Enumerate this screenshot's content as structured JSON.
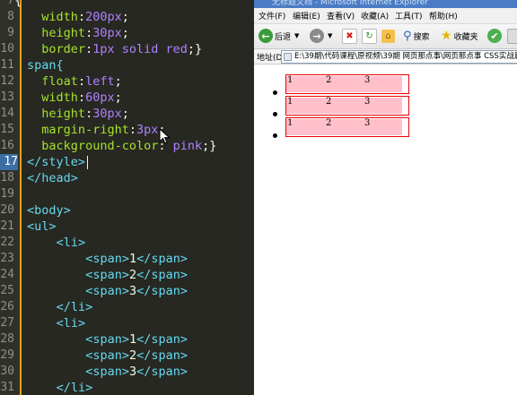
{
  "editor": {
    "lines": [
      {
        "num": "7",
        "text": "  {"
      },
      {
        "num": "8",
        "indent": 2,
        "prop": "width",
        "val": "200px"
      },
      {
        "num": "9",
        "indent": 2,
        "prop": "height",
        "val": "30px"
      },
      {
        "num": "10",
        "indent": 2,
        "prop": "border",
        "val": "1px solid red",
        "close": true
      },
      {
        "num": "11",
        "selector": "span{"
      },
      {
        "num": "12",
        "indent": 2,
        "prop": "float",
        "val": "left"
      },
      {
        "num": "13",
        "indent": 2,
        "prop": "width",
        "val": "60px"
      },
      {
        "num": "14",
        "indent": 2,
        "prop": "height",
        "val": "30px"
      },
      {
        "num": "15",
        "indent": 2,
        "prop": "margin-right",
        "val": "3px"
      },
      {
        "num": "16",
        "indent": 2,
        "prop": "background-color",
        "val": " pink",
        "close": true
      },
      {
        "num": "17",
        "tag": "</style>",
        "active": true
      },
      {
        "num": "18",
        "tag": "</head>"
      },
      {
        "num": "19",
        "text": ""
      },
      {
        "num": "20",
        "tag": "<body>"
      },
      {
        "num": "21",
        "tag": "<ul>"
      },
      {
        "num": "22",
        "indent": 4,
        "tag": "<li>"
      },
      {
        "num": "23",
        "indent": 8,
        "tag": "<span>",
        "inner": "1",
        "end": "</span>"
      },
      {
        "num": "24",
        "indent": 8,
        "tag": "<span>",
        "inner": "2",
        "end": "</span>"
      },
      {
        "num": "25",
        "indent": 8,
        "tag": "<span>",
        "inner": "3",
        "end": "</span>"
      },
      {
        "num": "26",
        "indent": 4,
        "tag": "</li>"
      },
      {
        "num": "27",
        "indent": 4,
        "tag": "<li>"
      },
      {
        "num": "28",
        "indent": 8,
        "tag": "<span>",
        "inner": "1",
        "end": "</span>"
      },
      {
        "num": "29",
        "indent": 8,
        "tag": "<span>",
        "inner": "2",
        "end": "</span>"
      },
      {
        "num": "30",
        "indent": 8,
        "tag": "<span>",
        "inner": "3",
        "end": "</span>"
      },
      {
        "num": "31",
        "indent": 4,
        "tag": "</li>"
      }
    ],
    "colors": {
      "background": "#272822",
      "property": "#a6e22e",
      "value": "#ae81ff",
      "tag": "#66d9ef",
      "gutter_accent": "#e4a11b"
    }
  },
  "browser": {
    "title": "无标题文档 - Microsoft Internet Explorer",
    "menu": [
      "文件(F)",
      "编辑(E)",
      "查看(V)",
      "收藏(A)",
      "工具(T)",
      "帮助(H)"
    ],
    "toolbar": {
      "back": "后退",
      "search": "搜索",
      "favorites": "收藏夹"
    },
    "address": {
      "label": "地址(D)",
      "value": "E:\\39期\\代码课程\\原视频\\39期 网页那点事\\网页那点事 CSS实战篇"
    },
    "list": [
      {
        "items": [
          "1",
          "2",
          "3"
        ]
      },
      {
        "items": [
          "1",
          "2",
          "3"
        ]
      },
      {
        "items": [
          "1",
          "2",
          "3"
        ]
      }
    ],
    "colors": {
      "box_border": "#ee0000",
      "span_bg": "#ffc0cb",
      "titlebar": "#4a7bc4"
    }
  }
}
